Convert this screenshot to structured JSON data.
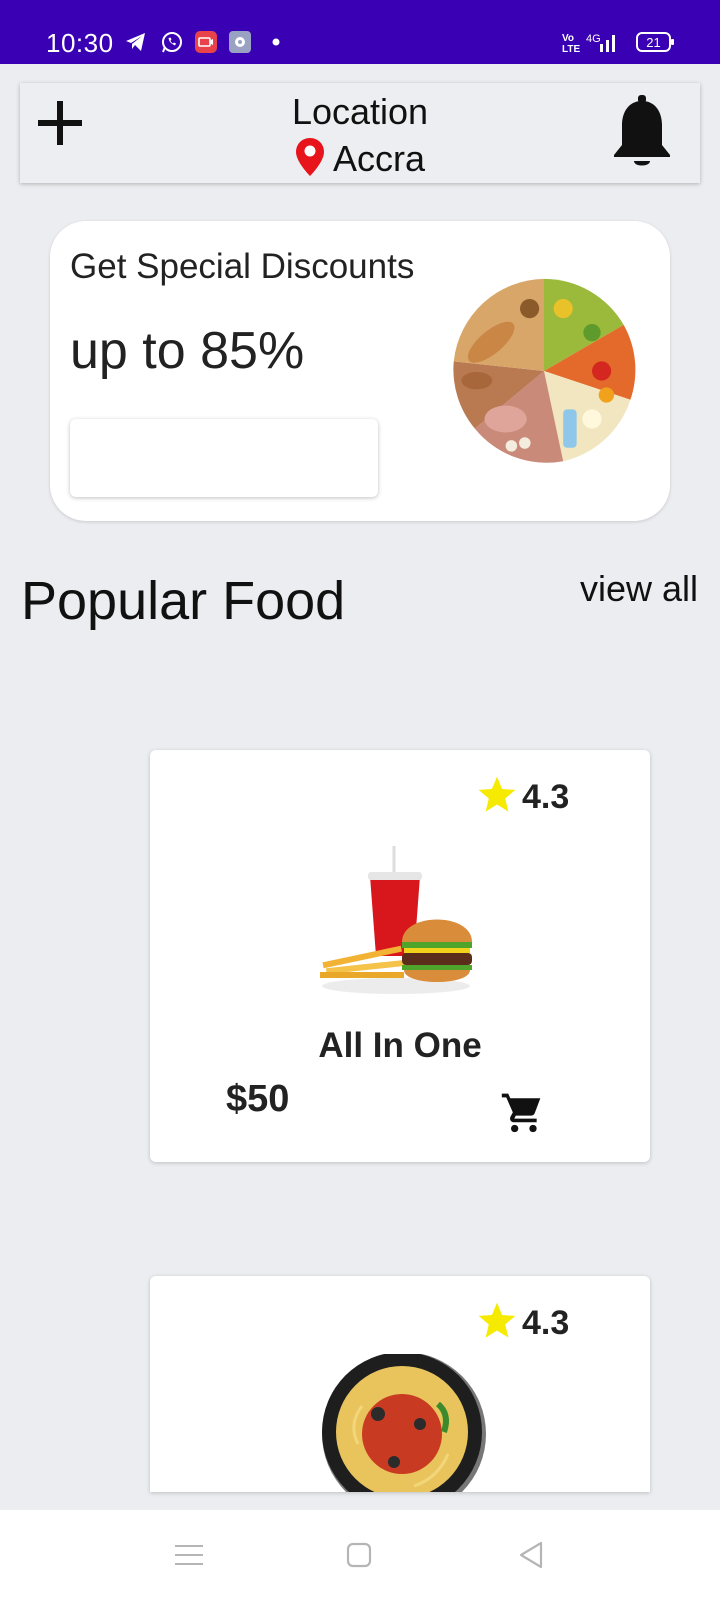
{
  "status_bar": {
    "time": "10:30",
    "icons": [
      "telegram-icon",
      "whatsapp-icon",
      "screen-recorder-icon",
      "settings-icon",
      "dot-icon"
    ],
    "network": "4G",
    "battery": "21",
    "bg_color": "#3a00b4"
  },
  "header": {
    "location_label": "Location",
    "city": "Accra",
    "pin_color": "#e8141b"
  },
  "promo": {
    "title": "Get Special Discounts",
    "subtitle": "up to 85%",
    "input_value": ""
  },
  "popular": {
    "title": "Popular Food",
    "view_all": "view all"
  },
  "foods": [
    {
      "rating": "4.3",
      "name": "All In One",
      "price": "$50"
    },
    {
      "rating": "4.3"
    }
  ],
  "colors": {
    "star": "#f5ea00",
    "background": "#ecedf0"
  }
}
